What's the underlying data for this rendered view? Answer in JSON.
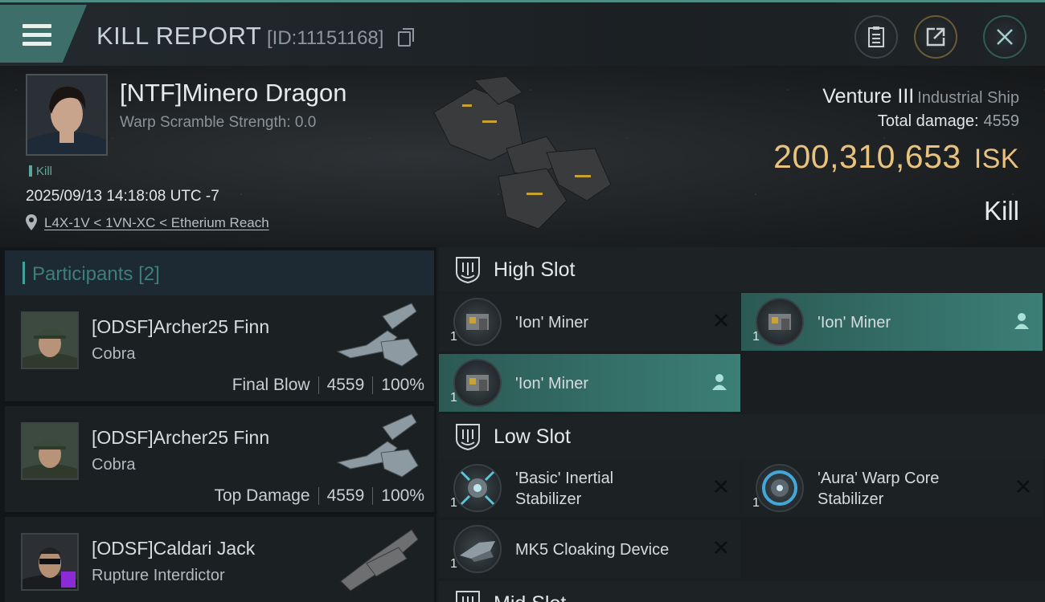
{
  "header": {
    "title": "KILL REPORT",
    "report_id": "[ID:11151168]",
    "menu_icon": "hamburger-icon",
    "buttons": [
      "clipboard-icon",
      "share-icon",
      "close-icon"
    ]
  },
  "victim": {
    "name": "[NTF]Minero Dragon",
    "warp_scramble": "Warp Scramble Strength: 0.0",
    "tag": "Kill",
    "time": "2025/09/13 14:18:08 UTC -7",
    "location": "L4X-1V < 1VN-XC < Etherium Reach",
    "ship_name": "Venture III",
    "ship_class": "Industrial Ship",
    "total_damage_label": "Total damage:",
    "total_damage": "4559",
    "isk_value": "200,310,653",
    "isk_unit": "ISK",
    "result": "Kill"
  },
  "participants": {
    "header": "Participants",
    "count": "[2]",
    "rows": [
      {
        "name": "[ODSF]Archer25 Finn",
        "ship": "Cobra",
        "role": "Final Blow",
        "damage": "4559",
        "percent": "100%"
      },
      {
        "name": "[ODSF]Archer25 Finn",
        "ship": "Cobra",
        "role": "Top Damage",
        "damage": "4559",
        "percent": "100%"
      },
      {
        "name": "[ODSF]Caldari Jack",
        "ship": "Rupture Interdictor"
      }
    ]
  },
  "fitting": {
    "high_slot": {
      "label": "High Slot",
      "modules": [
        {
          "name": "'Ion' Miner",
          "qty": "1",
          "status": "destroyed"
        },
        {
          "name": "'Ion' Miner",
          "qty": "1",
          "status": "dropped"
        },
        {
          "name": "'Ion' Miner",
          "qty": "1",
          "status": "dropped"
        }
      ]
    },
    "low_slot": {
      "label": "Low Slot",
      "modules": [
        {
          "name_line1": "'Basic' Inertial",
          "name_line2": "Stabilizer",
          "qty": "1",
          "status": "destroyed"
        },
        {
          "name_line1": "'Aura' Warp Core",
          "name_line2": "Stabilizer",
          "qty": "1",
          "status": "destroyed"
        },
        {
          "name": "MK5 Cloaking Device",
          "qty": "1",
          "status": "destroyed"
        }
      ]
    },
    "mid_slot": {
      "label": "Mid Slot"
    }
  },
  "colors": {
    "accent": "#3fa39a",
    "isk": "#e9c27e",
    "highlight": "#3b7f77"
  }
}
